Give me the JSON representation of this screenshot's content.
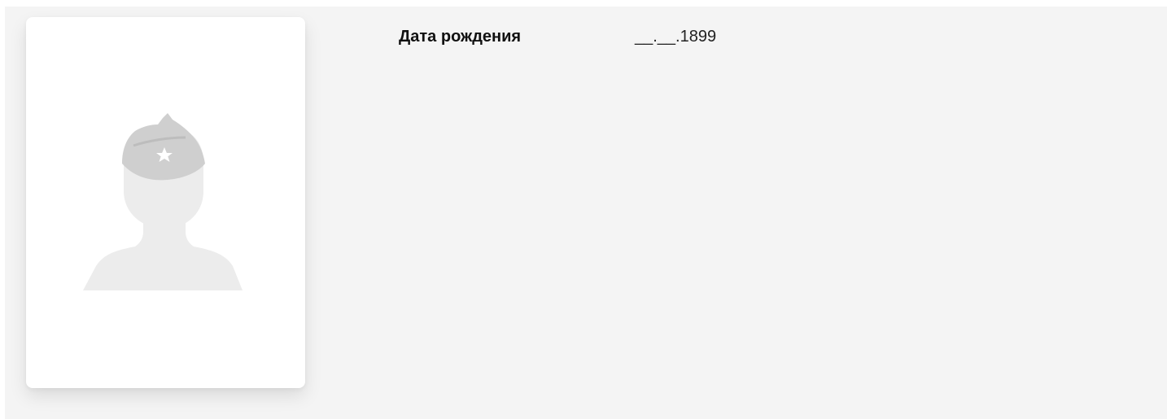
{
  "profile": {
    "photo": {
      "icon": "soldier-silhouette-icon",
      "badge_icon": "star-icon"
    },
    "fields": [
      {
        "label": "Дата рождения",
        "value": "__.__.1899"
      }
    ]
  },
  "colors": {
    "panel_background": "#f4f4f4",
    "card_background": "#ffffff",
    "silhouette": "#ececec",
    "cap": "#cfcfcf"
  }
}
